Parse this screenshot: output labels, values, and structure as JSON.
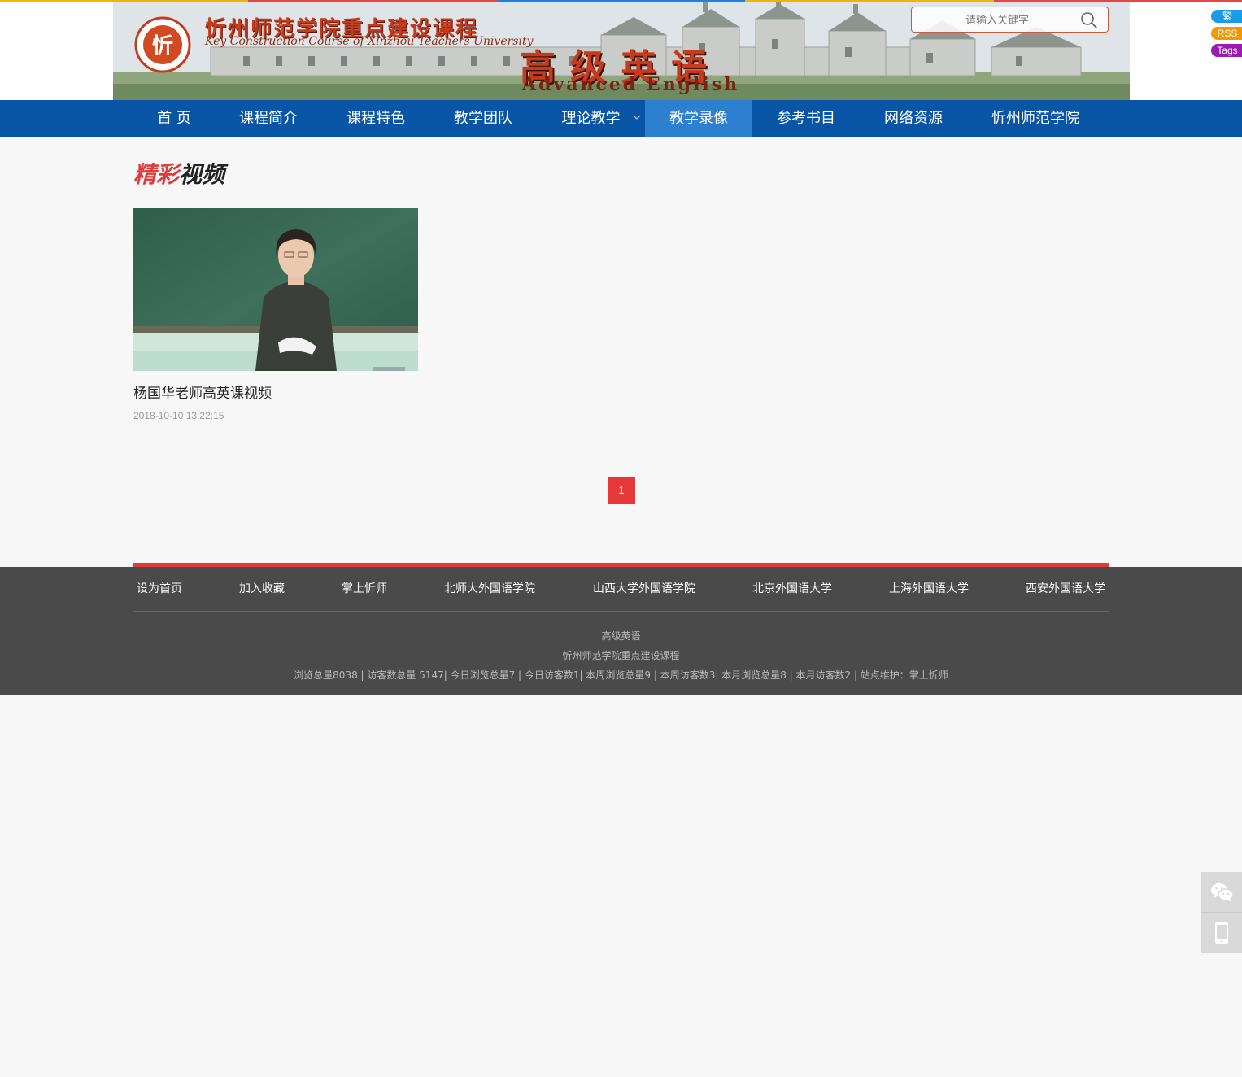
{
  "top_stripe_colors": [
    "#f4b400",
    "#e84545",
    "#1a84e3",
    "#f4b400",
    "#e84545"
  ],
  "banner": {
    "org_title": "忻州师范学院重点建设课程",
    "org_title_en": "Key Construction Course of Xinzhou Teachers University",
    "logo_char": "忻",
    "course_title": "高级英语",
    "course_title_en": "Advanced English"
  },
  "search": {
    "placeholder": "请输入关键字"
  },
  "side_tags": [
    {
      "label": "繁",
      "color": "#1a9be8"
    },
    {
      "label": "RSS",
      "color": "#f39800"
    },
    {
      "label": "Tags",
      "color": "#9b1ab1"
    }
  ],
  "nav": {
    "items": [
      {
        "label": "首 页"
      },
      {
        "label": "课程简介"
      },
      {
        "label": "课程特色"
      },
      {
        "label": "教学团队"
      },
      {
        "label": "理论教学"
      },
      {
        "label": "教学录像"
      },
      {
        "label": "参考书目"
      },
      {
        "label": "网络资源"
      },
      {
        "label": "忻州师范学院"
      }
    ],
    "active_index": 5,
    "bg_color": "#0955a5",
    "active_color": "#2d80d0"
  },
  "section": {
    "title_part1": "精彩",
    "title_part2": "视频"
  },
  "videos": [
    {
      "title": "杨国华老师高英课视频",
      "date": "2018-10-10 13:22:15"
    }
  ],
  "pagination": {
    "current": "1"
  },
  "footer": {
    "links": [
      {
        "label": "设为首页"
      },
      {
        "label": "加入收藏"
      },
      {
        "label": "掌上忻师"
      },
      {
        "label": "北师大外国语学院"
      },
      {
        "label": "山西大学外国语学院"
      },
      {
        "label": "北京外国语大学"
      },
      {
        "label": "上海外国语大学"
      },
      {
        "label": "西安外国语大学"
      }
    ],
    "line1": "高级英语",
    "line2": "忻州师范学院重点建设课程",
    "stats": "浏览总量8038 | 访客数总量 5147| 今日浏览总量7 | 今日访客数1| 本周浏览总量9 | 本周访客数3| 本月浏览总量8 | 本月访客数2 | 站点维护：掌上忻师"
  },
  "float_buttons": [
    {
      "icon": "wechat-icon"
    },
    {
      "icon": "mobile-icon"
    }
  ]
}
